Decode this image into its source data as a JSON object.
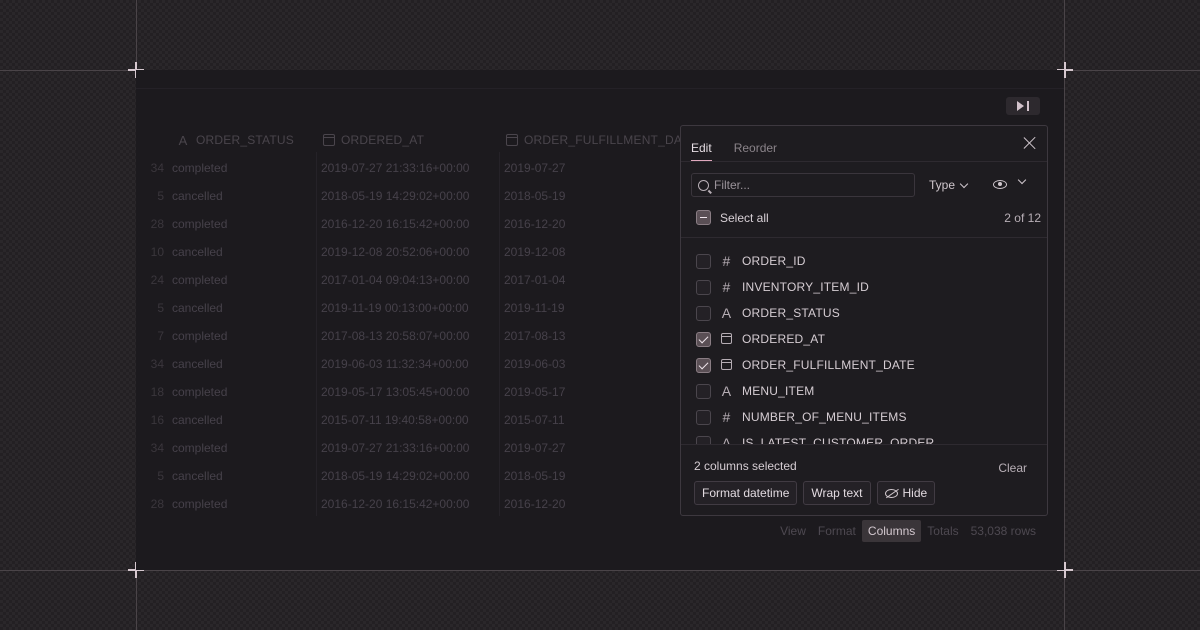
{
  "columns": {
    "status": "ORDER_STATUS",
    "ordered_at": "ORDERED_AT",
    "fulfillment": "ORDER_FULFILLMENT_DATE"
  },
  "rows": [
    {
      "n": "34",
      "status": "completed",
      "ordered_at": "2019-07-27 21:33:16+00:00",
      "fd": "2019-07-27"
    },
    {
      "n": "5",
      "status": "cancelled",
      "ordered_at": "2018-05-19 14:29:02+00:00",
      "fd": "2018-05-19"
    },
    {
      "n": "28",
      "status": "completed",
      "ordered_at": "2016-12-20 16:15:42+00:00",
      "fd": "2016-12-20"
    },
    {
      "n": "10",
      "status": "cancelled",
      "ordered_at": "2019-12-08 20:52:06+00:00",
      "fd": "2019-12-08"
    },
    {
      "n": "24",
      "status": "completed",
      "ordered_at": "2017-01-04 09:04:13+00:00",
      "fd": "2017-01-04"
    },
    {
      "n": "5",
      "status": "cancelled",
      "ordered_at": "2019-11-19 00:13:00+00:00",
      "fd": "2019-11-19"
    },
    {
      "n": "7",
      "status": "completed",
      "ordered_at": "2017-08-13 20:58:07+00:00",
      "fd": "2017-08-13"
    },
    {
      "n": "34",
      "status": "cancelled",
      "ordered_at": "2019-06-03 11:32:34+00:00",
      "fd": "2019-06-03"
    },
    {
      "n": "18",
      "status": "completed",
      "ordered_at": "2019-05-17 13:05:45+00:00",
      "fd": "2019-05-17"
    },
    {
      "n": "16",
      "status": "cancelled",
      "ordered_at": "2015-07-11 19:40:58+00:00",
      "fd": "2015-07-11"
    },
    {
      "n": "34",
      "status": "completed",
      "ordered_at": "2019-07-27 21:33:16+00:00",
      "fd": "2019-07-27"
    },
    {
      "n": "5",
      "status": "cancelled",
      "ordered_at": "2018-05-19 14:29:02+00:00",
      "fd": "2018-05-19"
    },
    {
      "n": "28",
      "status": "completed",
      "ordered_at": "2016-12-20 16:15:42+00:00",
      "fd": "2016-12-20"
    }
  ],
  "footer": {
    "view": "View",
    "format": "Format",
    "columns": "Columns",
    "totals": "Totals",
    "rows": "53,038 rows"
  },
  "panel": {
    "tab_edit": "Edit",
    "tab_reorder": "Reorder",
    "filter_placeholder": "Filter...",
    "type_label": "Type",
    "select_all": "Select all",
    "count": "2 of 12",
    "items": [
      {
        "label": "ORDER_ID",
        "type": "#",
        "icon": "number-icon",
        "checked": false
      },
      {
        "label": "INVENTORY_ITEM_ID",
        "type": "#",
        "icon": "number-icon",
        "checked": false
      },
      {
        "label": "ORDER_STATUS",
        "type": "A",
        "icon": "text-icon",
        "checked": false
      },
      {
        "label": "ORDERED_AT",
        "type": "date",
        "icon": "calendar-icon",
        "checked": true
      },
      {
        "label": "ORDER_FULFILLMENT_DATE",
        "type": "date",
        "icon": "calendar-icon",
        "checked": true
      },
      {
        "label": "MENU_ITEM",
        "type": "A",
        "icon": "text-icon",
        "checked": false
      },
      {
        "label": "NUMBER_OF_MENU_ITEMS",
        "type": "#",
        "icon": "number-icon",
        "checked": false
      },
      {
        "label": "IS_LATEST_CUSTOMER_ORDER",
        "type": "A",
        "icon": "text-icon",
        "checked": false
      }
    ],
    "selected_text": "2 columns selected",
    "clear": "Clear",
    "btn_format": "Format datetime",
    "btn_wrap": "Wrap text",
    "btn_hide": "Hide"
  }
}
